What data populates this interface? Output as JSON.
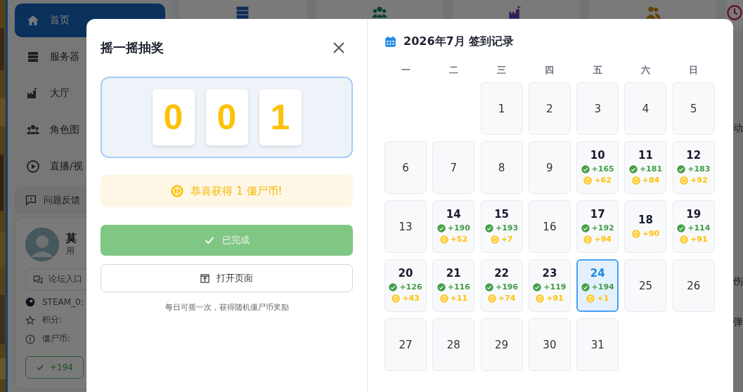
{
  "sidebar": {
    "items": [
      {
        "label": "首页",
        "selected": true
      },
      {
        "label": "服务器",
        "selected": false
      },
      {
        "label": "大厅",
        "selected": false
      },
      {
        "label": "角色图",
        "selected": false
      },
      {
        "label": "直播/视",
        "selected": false
      }
    ],
    "feedback": "问题反馈",
    "user": {
      "name": "莫",
      "role": "用",
      "forum_button": "论坛入口",
      "steam_id": "STEAM_0:",
      "points_label": "积分:",
      "coins_label": "僵尸币:",
      "checkin_badge": "+194"
    }
  },
  "right_fragments": [
    "动",
    "伤",
    "弹"
  ],
  "lottery": {
    "title": "摇一摇抽奖",
    "digits": [
      "0",
      "0",
      "1"
    ],
    "result": "恭喜获得 1 僵尸币!",
    "done_button": {
      "label": "已完成",
      "disabled": true
    },
    "open_button": "打开页面",
    "note": "每日可摇一次，获得随机僵尸币奖励"
  },
  "calendar": {
    "title": "2026年7月 签到记录",
    "weekdays": [
      "一",
      "二",
      "三",
      "四",
      "五",
      "六",
      "日"
    ],
    "weeks": [
      [
        {
          "kind": "empty"
        },
        {
          "kind": "empty"
        },
        {
          "day": "1",
          "selected": false
        },
        {
          "day": "2",
          "selected": false
        },
        {
          "day": "3",
          "selected": false
        },
        {
          "day": "4",
          "selected": false
        },
        {
          "day": "5",
          "selected": false
        }
      ],
      [
        {
          "day": "6",
          "selected": false
        },
        {
          "day": "7",
          "selected": false
        },
        {
          "day": "8",
          "selected": false
        },
        {
          "day": "9",
          "selected": false
        },
        {
          "day": "10",
          "points": "+165",
          "coins": "+62",
          "selected": false
        },
        {
          "day": "11",
          "points": "+181",
          "coins": "+84",
          "selected": false
        },
        {
          "day": "12",
          "points": "+183",
          "coins": "+92",
          "selected": false
        }
      ],
      [
        {
          "day": "13",
          "selected": false
        },
        {
          "day": "14",
          "points": "+190",
          "coins": "+52",
          "selected": false
        },
        {
          "day": "15",
          "points": "+193",
          "coins": "+7",
          "selected": false
        },
        {
          "day": "16",
          "selected": false
        },
        {
          "day": "17",
          "points": "+192",
          "coins": "+94",
          "selected": false
        },
        {
          "day": "18",
          "coins": "+90",
          "selected": false
        },
        {
          "day": "19",
          "points": "+114",
          "coins": "+91",
          "selected": false
        }
      ],
      [
        {
          "day": "20",
          "points": "+126",
          "coins": "+43",
          "selected": false
        },
        {
          "day": "21",
          "points": "+116",
          "coins": "+11",
          "selected": false
        },
        {
          "day": "22",
          "points": "+196",
          "coins": "+74",
          "selected": false
        },
        {
          "day": "23",
          "points": "+119",
          "coins": "+91",
          "selected": false
        },
        {
          "day": "24",
          "points": "+194",
          "coins": "+1",
          "selected": true
        },
        {
          "day": "25",
          "selected": false
        },
        {
          "day": "26",
          "selected": false
        }
      ],
      [
        {
          "day": "27",
          "selected": false
        },
        {
          "day": "28",
          "selected": false
        },
        {
          "day": "29",
          "selected": false
        },
        {
          "day": "30",
          "selected": false
        },
        {
          "day": "31",
          "selected": false
        },
        {
          "kind": "empty"
        },
        {
          "kind": "empty"
        }
      ]
    ]
  }
}
